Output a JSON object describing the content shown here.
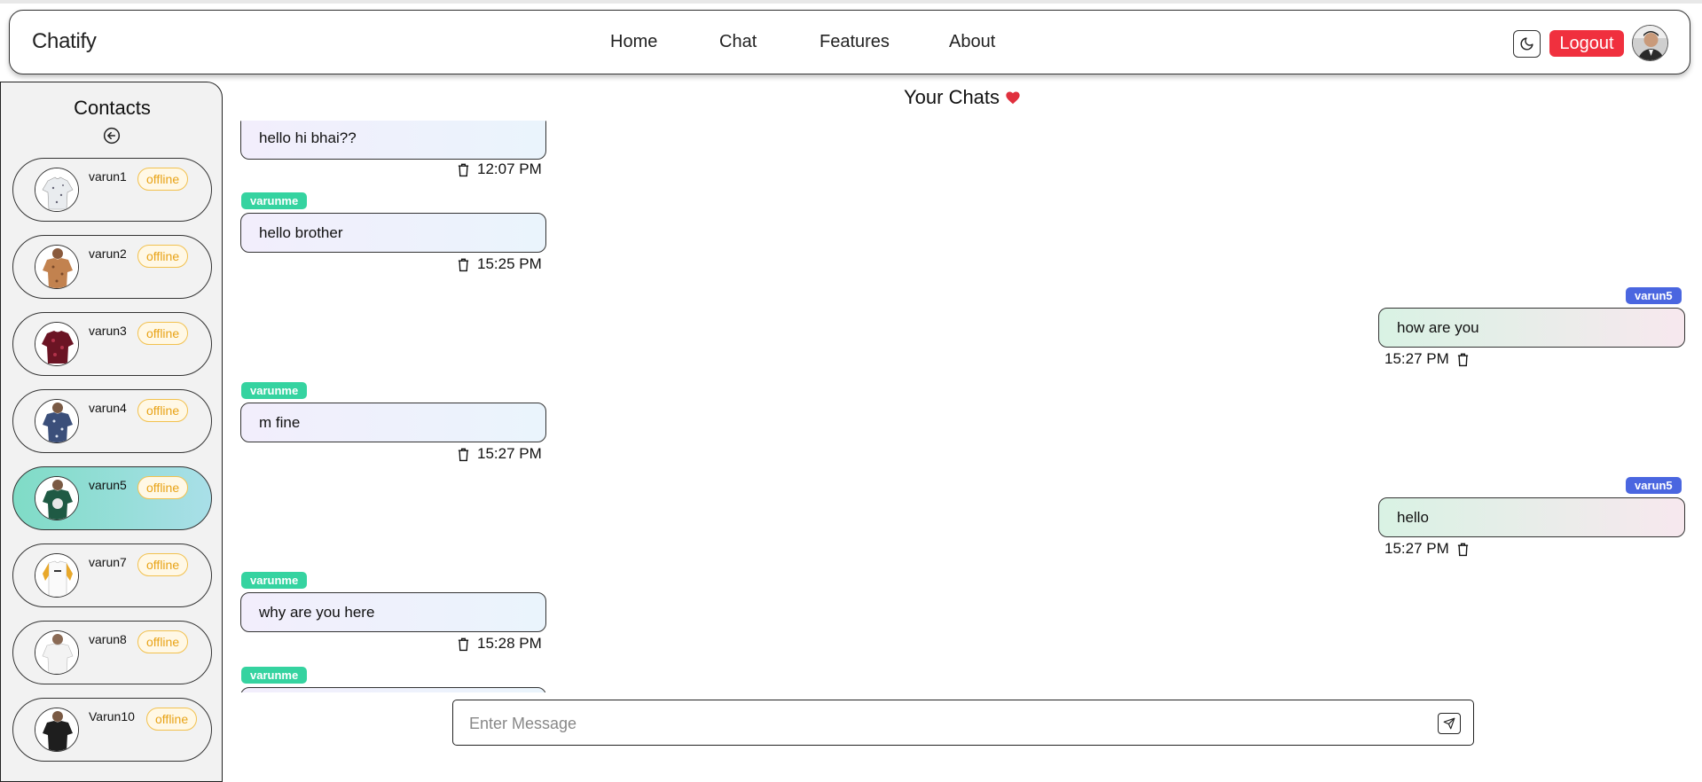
{
  "navbar": {
    "brand": "Chatify",
    "links": [
      "Home",
      "Chat",
      "Features",
      "About"
    ],
    "logout_label": "Logout"
  },
  "sidebar": {
    "title": "Contacts",
    "contacts": [
      {
        "name": "varun1",
        "status": "offline",
        "active": false
      },
      {
        "name": "varun2",
        "status": "offline",
        "active": false
      },
      {
        "name": "varun3",
        "status": "offline",
        "active": false
      },
      {
        "name": "varun4",
        "status": "offline",
        "active": false
      },
      {
        "name": "varun5",
        "status": "offline",
        "active": true
      },
      {
        "name": "varun7",
        "status": "offline",
        "active": false
      },
      {
        "name": "varun8",
        "status": "offline",
        "active": false
      },
      {
        "name": "Varun10",
        "status": "offline",
        "active": false
      }
    ]
  },
  "chat": {
    "title": "Your Chats",
    "messages": [
      {
        "direction": "in",
        "sender": "",
        "text": "hello hi bhai??",
        "time": "12:07 PM"
      },
      {
        "direction": "in",
        "sender": "varunme",
        "text": "hello brother",
        "time": "15:25 PM"
      },
      {
        "direction": "out",
        "sender": "varun5",
        "text": "how are you",
        "time": "15:27 PM"
      },
      {
        "direction": "in",
        "sender": "varunme",
        "text": "m fine",
        "time": "15:27 PM"
      },
      {
        "direction": "out",
        "sender": "varun5",
        "text": "hello",
        "time": "15:27 PM"
      },
      {
        "direction": "in",
        "sender": "varunme",
        "text": "why are you here",
        "time": "15:28 PM"
      },
      {
        "direction": "in",
        "sender": "varunme",
        "text": "",
        "time": ""
      }
    ]
  },
  "composer": {
    "placeholder": "Enter Message",
    "value": ""
  },
  "colors": {
    "logout": "#f0303e",
    "sender_me": "#35d3a0",
    "sender_them": "#4a66e0",
    "status_offline": "#e8a317",
    "heart": "#e0303e"
  }
}
